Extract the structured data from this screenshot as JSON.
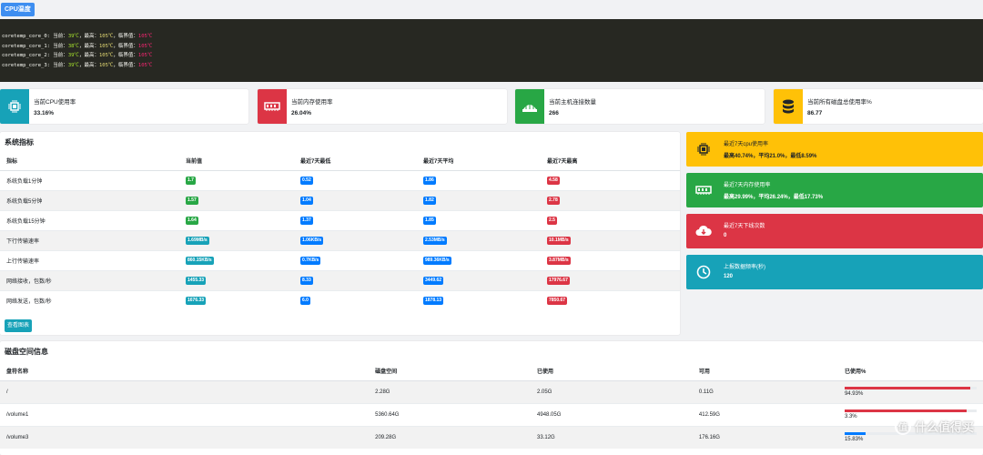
{
  "top": {
    "cpu_temp_button": "CPU温度"
  },
  "terminal": {
    "lines": [
      {
        "name": "coretemp_core_0:",
        "cur_label": "当前：",
        "cur": "39℃",
        "max_label": "，最高：",
        "max": "105℃",
        "crit_label": "，临界值：",
        "crit": "105℃"
      },
      {
        "name": "coretemp_core_1:",
        "cur_label": "当前：",
        "cur": "38℃",
        "max_label": "，最高：",
        "max": "105℃",
        "crit_label": "，临界值：",
        "crit": "105℃"
      },
      {
        "name": "coretemp_core_2:",
        "cur_label": "当前：",
        "cur": "39℃",
        "max_label": "，最高：",
        "max": "105℃",
        "crit_label": "，临界值：",
        "crit": "105℃"
      },
      {
        "name": "coretemp_core_3:",
        "cur_label": "当前：",
        "cur": "39℃",
        "max_label": "，最高：",
        "max": "105℃",
        "crit_label": "，临界值：",
        "crit": "105℃"
      }
    ]
  },
  "stats": [
    {
      "label": "当前CPU使用率",
      "value": "33.16%",
      "color": "#17a2b8",
      "icon": "cpu-icon"
    },
    {
      "label": "当前内存使用率",
      "value": "26.04%",
      "color": "#dc3545",
      "icon": "memory-icon"
    },
    {
      "label": "当前主机连接数量",
      "value": "266",
      "color": "#28a745",
      "icon": "network-icon"
    },
    {
      "label": "当前所有磁盘总使用率%",
      "value": "86.77",
      "color": "#ffc107",
      "icon": "database-icon"
    }
  ],
  "system": {
    "title": "系统指标",
    "headers": [
      "指标",
      "当前值",
      "最近7天最低",
      "最近7天平均",
      "最近7天最高"
    ],
    "rows": [
      {
        "name": "系统负载1分钟",
        "cur": "1.7",
        "min": "0.52",
        "avg": "1.86",
        "max": "4.58",
        "cur_color": "green"
      },
      {
        "name": "系统负载5分钟",
        "cur": "1.57",
        "min": "1.04",
        "avg": "1.82",
        "max": "2.78",
        "cur_color": "green"
      },
      {
        "name": "系统负载15分钟",
        "cur": "1.64",
        "min": "1.37",
        "avg": "1.85",
        "max": "2.5",
        "cur_color": "green"
      },
      {
        "name": "下行传输速率",
        "cur": "1.69MB/s",
        "min": "1.06KB/s",
        "avg": "2.53MB/s",
        "max": "10.1MB/s",
        "cur_color": "cyan"
      },
      {
        "name": "上行传输速率",
        "cur": "860.15KB/s",
        "min": "0.7KB/s",
        "avg": "989.36KB/s",
        "max": "3.87MB/s",
        "cur_color": "cyan"
      },
      {
        "name": "网络接收，包数/秒",
        "cur": "1455.33",
        "min": "8.33",
        "avg": "3449.62",
        "max": "17976.67",
        "cur_color": "cyan"
      },
      {
        "name": "网络发送，包数/秒",
        "cur": "1676.33",
        "min": "6.0",
        "avg": "1878.13",
        "max": "7850.67",
        "cur_color": "cyan"
      }
    ],
    "chart_button": "查看图表"
  },
  "side": [
    {
      "label": "最近7天cpu使用率",
      "value": "最高40.74%，平均21.0%，最低8.59%",
      "bg": "#ffc107",
      "fg": "#212529",
      "icon": "cpu-icon"
    },
    {
      "label": "最近7天内存使用率",
      "value": "最高29.99%，平均26.24%，最低17.73%",
      "bg": "#28a745",
      "fg": "#ffffff",
      "icon": "memory-icon"
    },
    {
      "label": "最近7天下线次数",
      "value": "0",
      "bg": "#dc3545",
      "fg": "#ffffff",
      "icon": "cloud-download-icon"
    },
    {
      "label": "上报数据频率(秒)",
      "value": "120",
      "bg": "#17a2b8",
      "fg": "#ffffff",
      "icon": "clock-icon"
    }
  ],
  "disk": {
    "title": "磁盘空间信息",
    "headers": [
      "盘符名称",
      "磁盘空间",
      "已使用",
      "可用",
      "已使用%"
    ],
    "rows": [
      {
        "name": "/",
        "size": "2.28G",
        "used": "2.05G",
        "free": "0.11G",
        "pct": "94.93%",
        "pct_value": 94.93,
        "color": "#dc3545"
      },
      {
        "name": "/volume1",
        "size": "5360.64G",
        "used": "4948.05G",
        "free": "412.59G",
        "pct": "3.3%",
        "pct_value": 92.3,
        "color": "#dc3545"
      },
      {
        "name": "/volume3",
        "size": "209.28G",
        "used": "33.12G",
        "free": "176.16G",
        "pct": "15.83%",
        "pct_value": 15.83,
        "color": "#007bff"
      }
    ]
  },
  "watermark": {
    "circle": "值",
    "text": "什么值得买"
  }
}
